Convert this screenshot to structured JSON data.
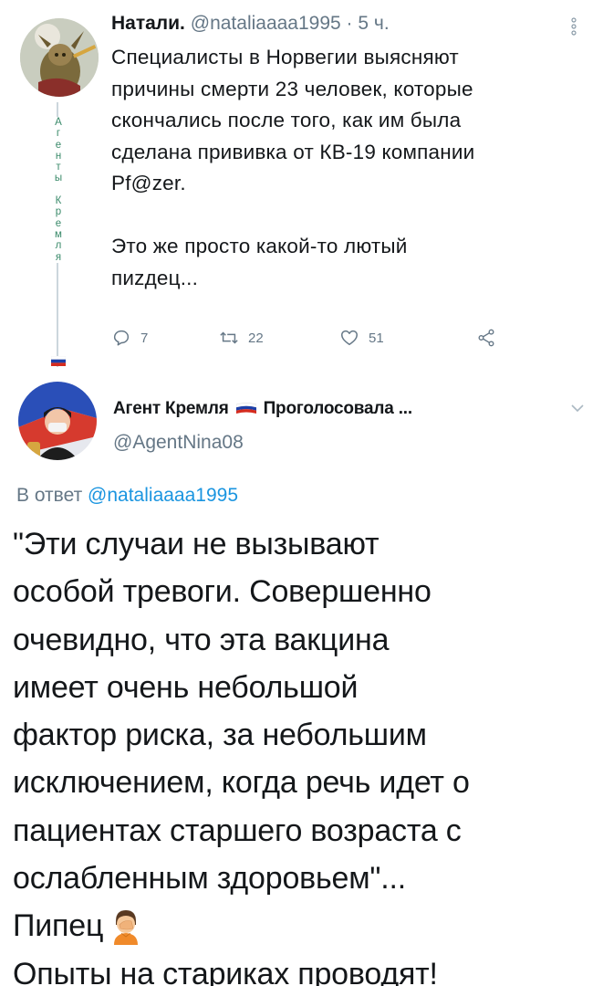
{
  "tweet1": {
    "author_name": "Натали.",
    "author_handle": "@nataliaaaa1995",
    "separator": " · ",
    "timestamp": "5 ч.",
    "text_lines": [
      "Специалисты в Норвегии выясняют",
      "причины смерти 23 человек, которые",
      "скончались после того, как им была",
      "сделана прививка от КВ-19 компании",
      "Pf@zer.",
      "",
      "Это же просто какой-то лютый",
      "пиzдец..."
    ],
    "replies": "7",
    "retweets": "22",
    "likes": "51",
    "thread_vertical_text": [
      "А",
      "г",
      "е",
      "н",
      "т",
      "ы",
      " ",
      "К",
      "р",
      "е",
      "м",
      "л",
      "я"
    ]
  },
  "tweet2": {
    "author_name_left": "Агент Кремля",
    "author_name_right": "Проголосовала ...",
    "author_handle": "@AgentNina08",
    "reply_prefix": "В ответ",
    "reply_mention": "@nataliaaaa1995",
    "text_lines": [
      "\"Эти случаи не вызывают",
      "особой тревоги. Совершенно",
      "очевидно, что эта вакцина",
      "имеет очень небольшой",
      "фактор риска, за небольшим",
      "исключением, когда речь идет о",
      "пациентах старшего возраста с",
      "ослабленным здоровьем\"...",
      "Пипец",
      "Опыты на стариках проводят!"
    ]
  },
  "colors": {
    "text": "#14171a",
    "secondary": "#657786",
    "link": "#1b95e0",
    "thread_text": "#3a8a6a"
  },
  "icons": {
    "reply": "speech-bubble-icon",
    "retweet": "retweet-icon",
    "like": "heart-icon",
    "share": "share-icon",
    "more": "vertical-dots-icon",
    "caret": "chevron-down-icon",
    "flag": "russian-flag-icon",
    "emoji": "face-palm-emoji"
  }
}
